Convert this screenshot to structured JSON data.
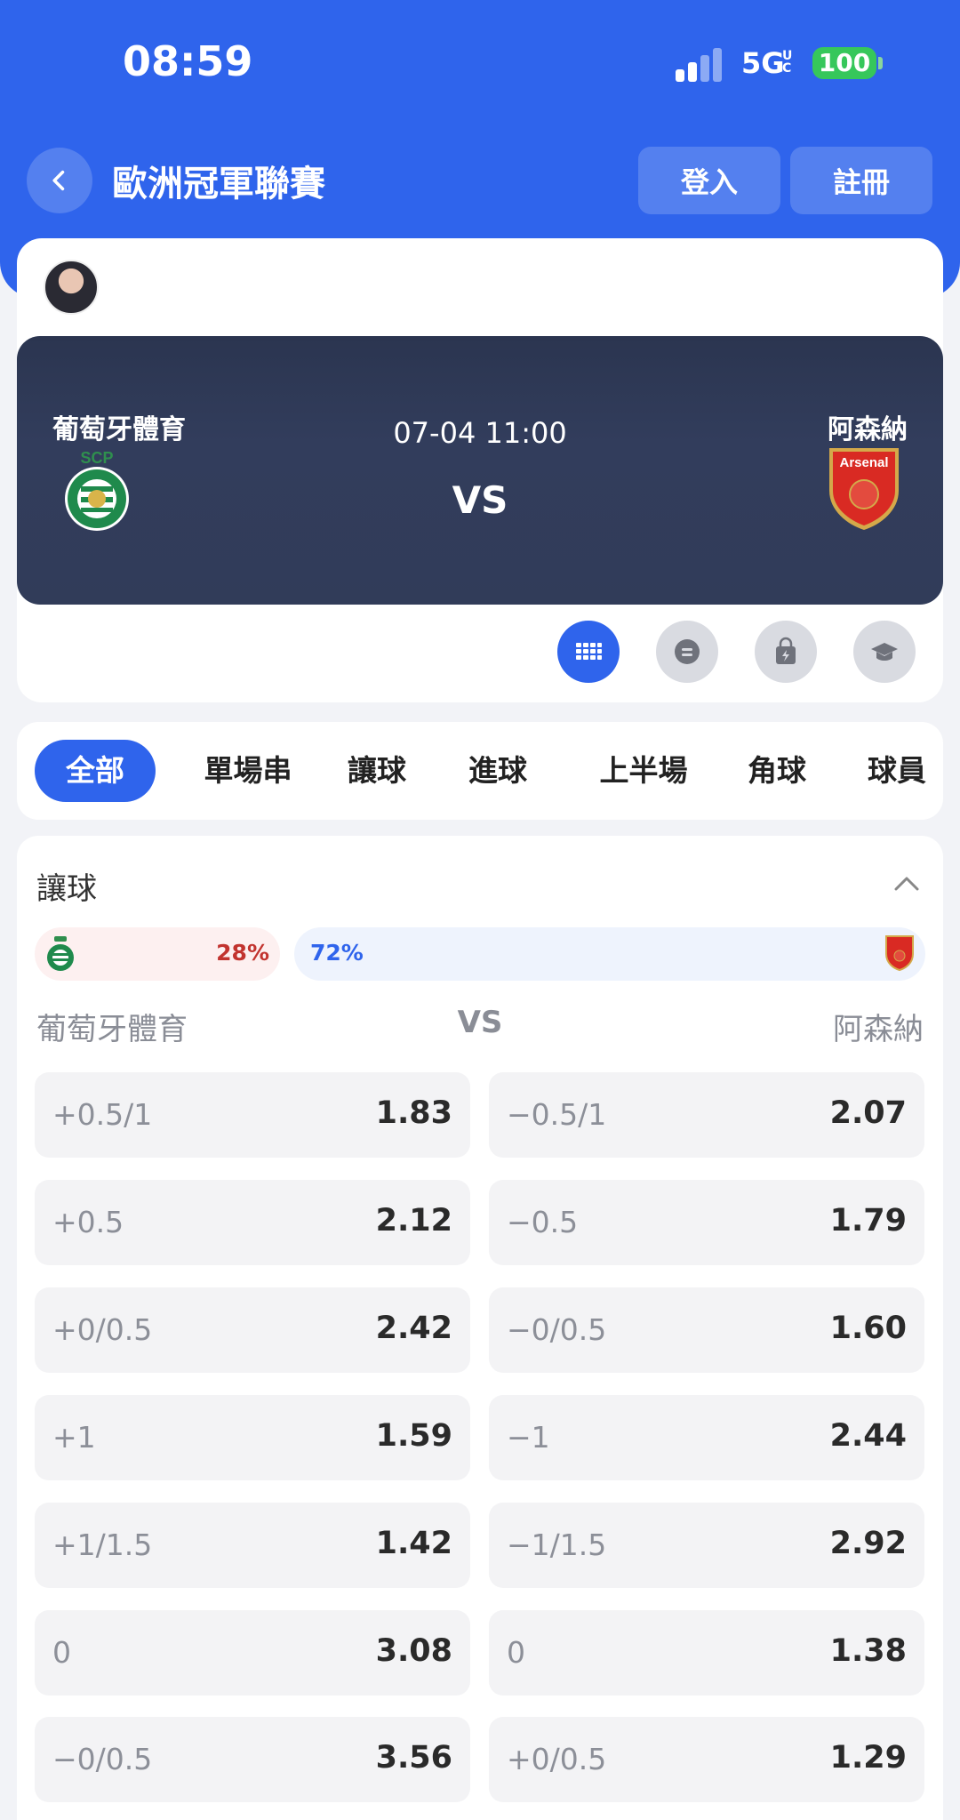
{
  "status_bar": {
    "time": "08:59",
    "network": "5G",
    "network_sub": "UC",
    "battery": "100"
  },
  "header": {
    "title": "歐洲冠軍聯賽",
    "login": "登入",
    "register": "註冊"
  },
  "colors": {
    "primary": "#2f64ec",
    "home_accent": "#c2342f",
    "away_accent": "#2f64ec"
  },
  "match": {
    "home_team": "葡萄牙體育",
    "away_team": "阿森納",
    "datetime": "07-04 11:00",
    "vs": "VS",
    "home_crest_text": "SCP",
    "away_crest_text": "Arsenal",
    "action_icons": [
      "grid-icon",
      "chat-icon",
      "bag-icon",
      "cap-icon"
    ]
  },
  "tabs": [
    "全部",
    "單場串",
    "讓球",
    "進球",
    "上半場",
    "角球",
    "球員"
  ],
  "odds": {
    "section_title": "讓球",
    "home_pct": "28%",
    "away_pct": "72%",
    "home_label": "葡萄牙體育",
    "vs_label": "VS",
    "away_label": "阿森納",
    "rows": [
      {
        "home_line": "+0.5/1",
        "home_price": "1.83",
        "away_line": "−0.5/1",
        "away_price": "2.07"
      },
      {
        "home_line": "+0.5",
        "home_price": "2.12",
        "away_line": "−0.5",
        "away_price": "1.79"
      },
      {
        "home_line": "+0/0.5",
        "home_price": "2.42",
        "away_line": "−0/0.5",
        "away_price": "1.60"
      },
      {
        "home_line": "+1",
        "home_price": "1.59",
        "away_line": "−1",
        "away_price": "2.44"
      },
      {
        "home_line": "+1/1.5",
        "home_price": "1.42",
        "away_line": "−1/1.5",
        "away_price": "2.92"
      },
      {
        "home_line": "0",
        "home_price": "3.08",
        "away_line": "0",
        "away_price": "1.38"
      },
      {
        "home_line": "−0/0.5",
        "home_price": "3.56",
        "away_line": "+0/0.5",
        "away_price": "1.29"
      }
    ]
  }
}
